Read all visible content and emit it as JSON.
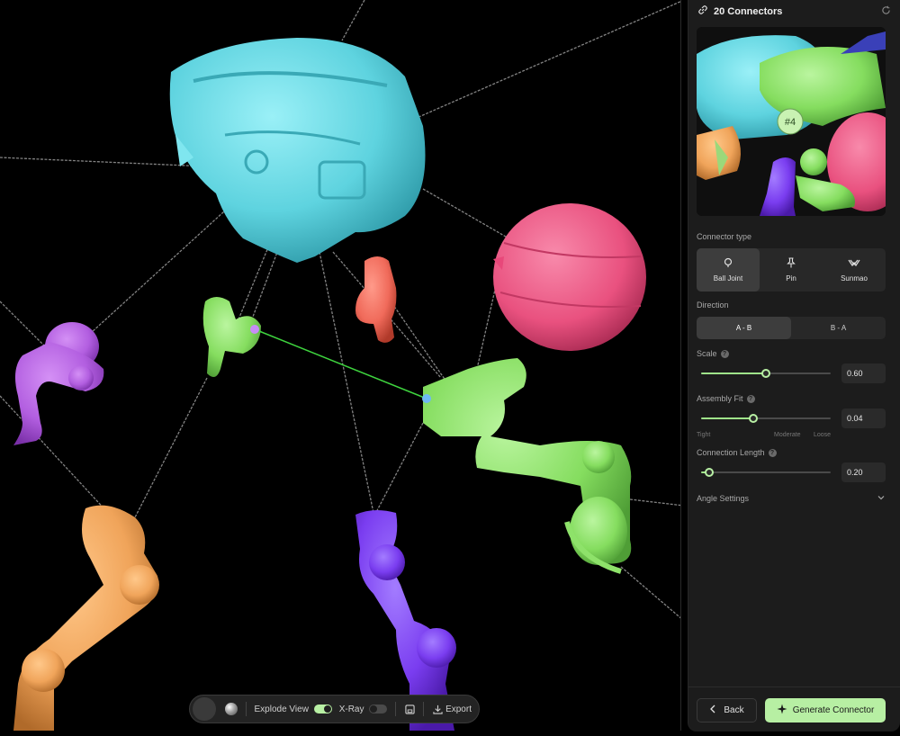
{
  "viewport": {
    "toolbar": {
      "explode_view_label": "Explode View",
      "explode_view_on": true,
      "xray_label": "X-Ray",
      "xray_on": false,
      "export_label": "Export"
    }
  },
  "panel": {
    "title": "20 Connectors",
    "preview_badge": "#4",
    "connector_type": {
      "label": "Connector type",
      "options": [
        {
          "label": "Ball Joint",
          "icon": "ball-joint-icon",
          "active": true
        },
        {
          "label": "Pin",
          "icon": "pin-icon",
          "active": false
        },
        {
          "label": "Sunmao",
          "icon": "sunmao-icon",
          "active": false
        }
      ]
    },
    "direction": {
      "label": "Direction",
      "options": [
        {
          "label": "A - B",
          "active": true
        },
        {
          "label": "B - A",
          "active": false
        }
      ]
    },
    "scale": {
      "label": "Scale",
      "value": "0.60",
      "fraction": 0.5
    },
    "assembly_fit": {
      "label": "Assembly Fit",
      "value": "0.04",
      "fraction": 0.4,
      "ticks": [
        "Tight",
        "Moderate",
        "Loose"
      ]
    },
    "connection_length": {
      "label": "Connection Length",
      "value": "0.20",
      "fraction": 0.06
    },
    "angle_settings_label": "Angle Settings",
    "back_label": "Back",
    "generate_label": "Generate Connector"
  },
  "colors": {
    "accent": "#b7efa3",
    "cyan_part": "#5ed3df",
    "pink_part": "#ec5e86",
    "green_part": "#8ee26a",
    "purple_part": "#b25ee0",
    "orange_part": "#f0a45a",
    "violet_part": "#7a3df0",
    "red_part": "#f06a5a"
  }
}
